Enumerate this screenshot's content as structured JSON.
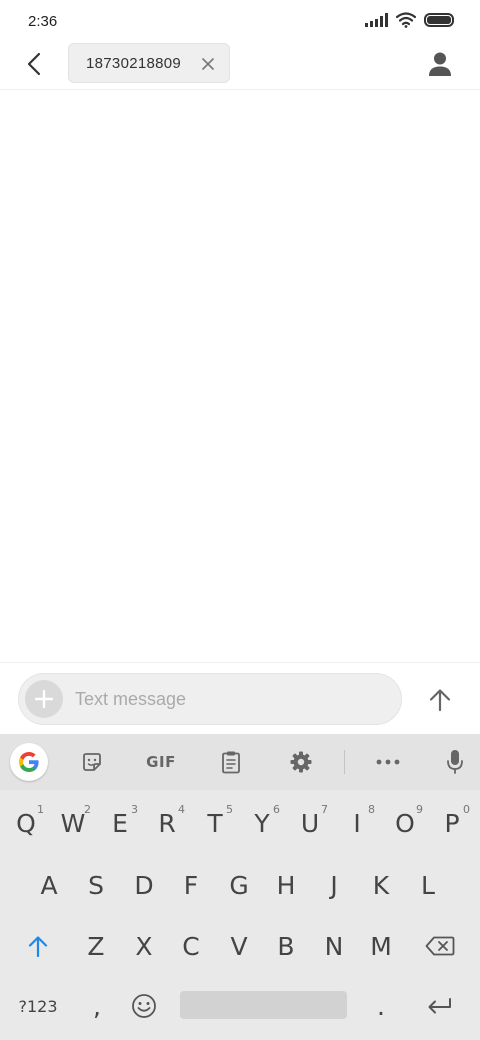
{
  "status_bar": {
    "time": "2:36"
  },
  "header": {
    "back_icon": "chevron-left-icon",
    "recipient": "18730218809",
    "remove_icon": "close-icon",
    "contact_icon": "person-icon"
  },
  "compose": {
    "placeholder": "Text message",
    "add_icon": "plus-icon",
    "send_icon": "arrow-up-icon"
  },
  "keyboard": {
    "toolbar": {
      "google_icon": "google-g-icon",
      "sticker_icon": "sticker-icon",
      "gif_label": "GIF",
      "clipboard_icon": "clipboard-icon",
      "settings_icon": "gear-icon",
      "more_icon": "more-horizontal-icon",
      "mic_icon": "microphone-icon"
    },
    "row1": [
      {
        "key": "Q",
        "hint": "1"
      },
      {
        "key": "W",
        "hint": "2"
      },
      {
        "key": "E",
        "hint": "3"
      },
      {
        "key": "R",
        "hint": "4"
      },
      {
        "key": "T",
        "hint": "5"
      },
      {
        "key": "Y",
        "hint": "6"
      },
      {
        "key": "U",
        "hint": "7"
      },
      {
        "key": "I",
        "hint": "8"
      },
      {
        "key": "O",
        "hint": "9"
      },
      {
        "key": "P",
        "hint": "0"
      }
    ],
    "row2": [
      "A",
      "S",
      "D",
      "F",
      "G",
      "H",
      "J",
      "K",
      "L"
    ],
    "row3": [
      "Z",
      "X",
      "C",
      "V",
      "B",
      "N",
      "M"
    ],
    "symbols_label": "?123",
    "comma": ",",
    "period": ".",
    "shift_icon": "shift-arrow-icon",
    "backspace_icon": "backspace-icon",
    "emoji_icon": "emoji-icon",
    "enter_icon": "enter-icon"
  },
  "colors": {
    "shift_active": "#1e88e5",
    "keyboard_bg": "#e9e9e9"
  }
}
